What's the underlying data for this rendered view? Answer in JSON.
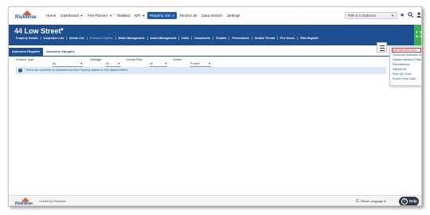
{
  "brand": {
    "name": "RiskWise",
    "colors": {
      "primary": "#1d4f91",
      "accent": "#38b24a",
      "alert": "#d33"
    }
  },
  "topnav": {
    "items": [
      {
        "label": "Home",
        "caret": false
      },
      {
        "label": "Dashboard",
        "caret": true
      },
      {
        "label": "Fire Planner",
        "caret": true
      },
      {
        "label": "TaskBot",
        "caret": false
      },
      {
        "label": "KPI",
        "caret": true
      },
      {
        "label": "Property List",
        "caret": true,
        "active": true
      },
      {
        "label": "Tenant List",
        "caret": false
      },
      {
        "label": "Data Search",
        "caret": false
      },
      {
        "label": "Settings",
        "caret": false
      }
    ],
    "site_select": "Risk & Compliance",
    "icons": [
      "star-icon",
      "search-icon",
      "user-add-icon"
    ]
  },
  "property": {
    "title": "44 Low Street",
    "subnav": [
      {
        "label": "Property Details",
        "dim": false
      },
      {
        "label": "Inspection List",
        "dim": false
      },
      {
        "label": "Action List",
        "dim": false
      },
      {
        "label": "Asbestos Register",
        "dim": true
      },
      {
        "label": "Water Management",
        "dim": false
      },
      {
        "label": "Asset Management",
        "dim": false
      },
      {
        "label": "Units",
        "dim": false
      },
      {
        "label": "Documents",
        "dim": false
      },
      {
        "label": "Tenants",
        "dim": false
      },
      {
        "label": "Permissions",
        "dim": false
      },
      {
        "label": "Golden Thread",
        "dim": false
      },
      {
        "label": "Fire Doors",
        "dim": false
      },
      {
        "label": "Risk Register",
        "dim": false
      }
    ]
  },
  "tabs": [
    {
      "label": "Asbestos Register",
      "active": true
    },
    {
      "label": "Asbestos Samples",
      "active": false
    }
  ],
  "filters": [
    {
      "label": "Product Type:",
      "value": "All"
    },
    {
      "label": "Damage:",
      "value": "All"
    },
    {
      "label": "Overall Risk:",
      "value": "All"
    },
    {
      "label": "Status:",
      "value": "Present"
    }
  ],
  "info_message": "There are currently no Asbestos for this Property based on the applied filters",
  "dropdown": {
    "items": [
      {
        "label": "Add Asbestos Item",
        "highlight": true
      },
      {
        "label": "Download Asbestos Data",
        "highlight": false
      },
      {
        "label": "Upload Asbestos Data",
        "highlight": false
      },
      {
        "label": "Edit Asbestos",
        "highlight": false
      },
      {
        "label": "Sample All",
        "highlight": false
      },
      {
        "label": "Print QR Code",
        "highlight": false
      },
      {
        "label": "Export Excel Data",
        "highlight": false
      }
    ]
  },
  "footer": {
    "hosted": "Hosted by RiskWise",
    "language": "Select Language",
    "help": "Help"
  }
}
